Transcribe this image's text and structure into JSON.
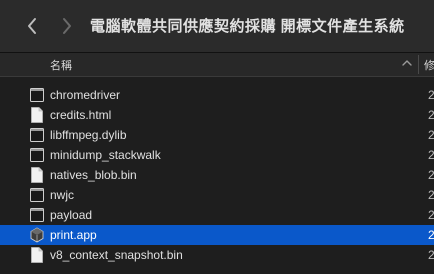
{
  "window": {
    "title": "電腦軟體共同供應契約採購 開標文件產生系統"
  },
  "header": {
    "name_column": "名稱",
    "date_column": "修"
  },
  "files": [
    {
      "name": "chromedriver",
      "icon": "exec-icon",
      "date": "2"
    },
    {
      "name": "credits.html",
      "icon": "document-icon",
      "date": "2"
    },
    {
      "name": "libffmpeg.dylib",
      "icon": "exec-icon",
      "date": "2"
    },
    {
      "name": "minidump_stackwalk",
      "icon": "exec-icon",
      "date": "2"
    },
    {
      "name": "natives_blob.bin",
      "icon": "document-icon",
      "date": "2"
    },
    {
      "name": "nwjc",
      "icon": "exec-icon",
      "date": "2"
    },
    {
      "name": "payload",
      "icon": "exec-icon",
      "date": "2"
    },
    {
      "name": "print.app",
      "icon": "app-icon",
      "date": "2",
      "selected": true
    },
    {
      "name": "v8_context_snapshot.bin",
      "icon": "document-icon",
      "date": "2"
    }
  ],
  "colors": {
    "selection": "#0a58ca",
    "background": "#1e1e1e",
    "toolbar": "#2b2b2b"
  }
}
